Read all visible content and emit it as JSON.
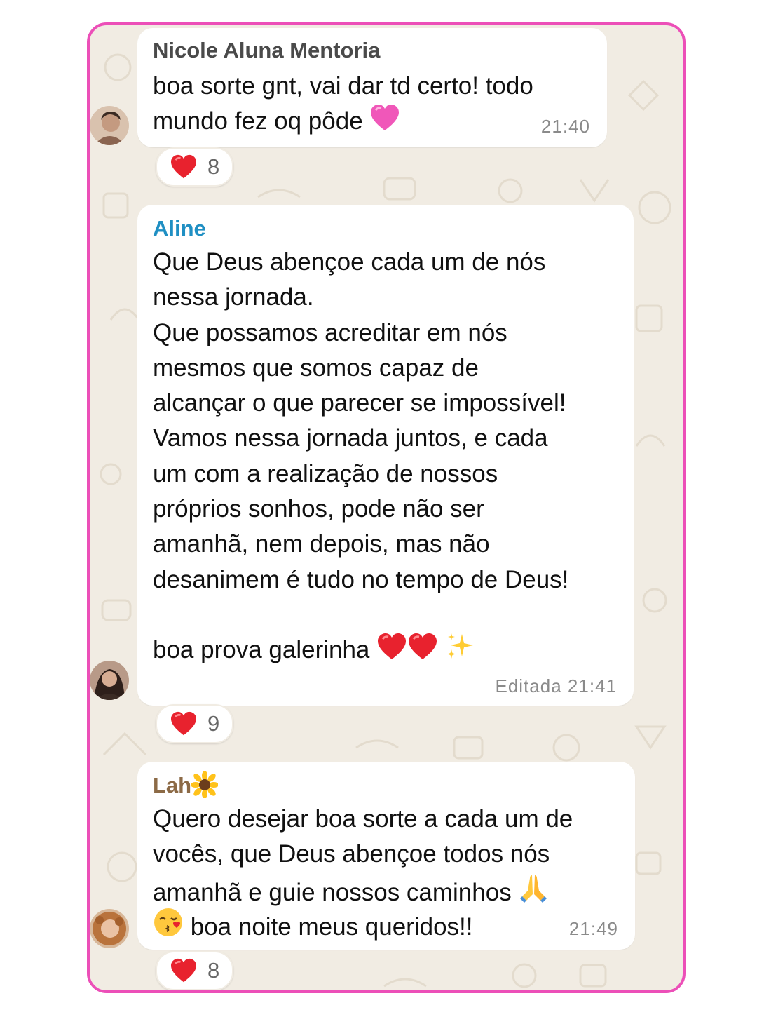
{
  "messages": [
    {
      "sender": "Nicole Aluna Mentoria",
      "sender_color": "#4a4a4a",
      "text": "boa sorte gnt, vai dar td certo! todo\nmundo fez oq pôde",
      "trailing_emoji": "pink-heart-icon",
      "time": "21:40",
      "reaction": {
        "emoji": "red-heart-icon",
        "count": "8"
      }
    },
    {
      "sender": "Aline",
      "sender_color": "#1f8fc3",
      "text": "Que Deus abençoe cada um de nós\nnessa jornada.\nQue possamos acreditar em nós\nmesmos que somos capaz de\nalcançar o que parecer se impossível!\nVamos nessa jornada juntos, e cada\num com a realização de nossos\npróprios sonhos, pode não ser\namanhã, nem depois, mas não\ndesanimem é tudo no tempo de Deus!",
      "closing_text": "boa prova galerinha",
      "closing_emojis": [
        "red-heart-icon",
        "red-heart-icon",
        "sparkles-icon"
      ],
      "edited_label": "Editada",
      "time": "21:41",
      "reaction": {
        "emoji": "red-heart-icon",
        "count": "9"
      }
    },
    {
      "sender": "Lah",
      "sender_emoji": "sunflower-icon",
      "sender_color": "#8c6a46",
      "text": "Quero desejar boa sorte a cada um de\nvocês, que Deus abençoe todos nós\namanhã e guie nossos caminhos",
      "line3_emoji": "praying-hands-icon",
      "last_line_emoji": "kiss-face-icon",
      "last_line_text": "boa noite meus queridos!!",
      "time": "21:49",
      "reaction": {
        "emoji": "red-heart-icon",
        "count": "8"
      }
    }
  ],
  "colors": {
    "frame_border": "#ec4fb8",
    "chat_background": "#f1ece3",
    "bubble": "#ffffff"
  }
}
